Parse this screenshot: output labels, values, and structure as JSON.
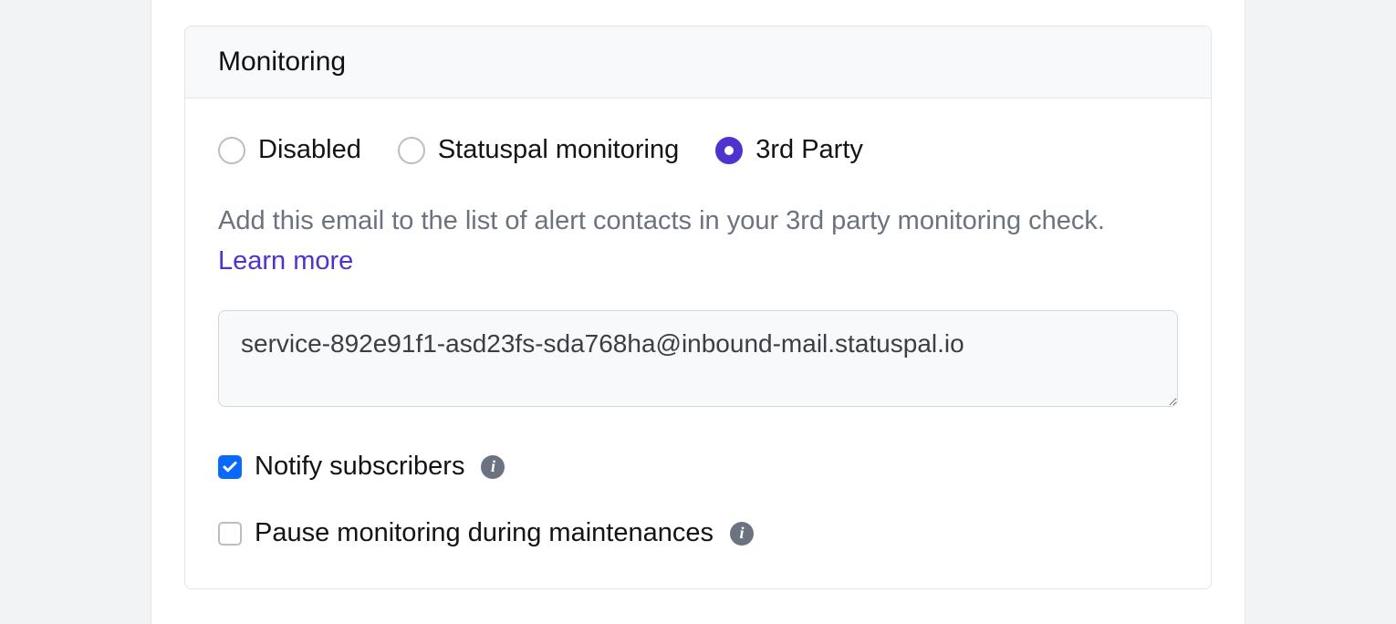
{
  "panel": {
    "title": "Monitoring"
  },
  "radios": {
    "disabled": "Disabled",
    "statuspal": "Statuspal monitoring",
    "third_party": "3rd Party",
    "selected": "third_party"
  },
  "help": {
    "text": "Add this email to the list of alert contacts in your 3rd party monitoring check. ",
    "link": "Learn more"
  },
  "email": {
    "value": "service-892e91f1-asd23fs-sda768ha@inbound-mail.statuspal.io"
  },
  "checkboxes": {
    "notify": {
      "label": "Notify subscribers",
      "checked": true
    },
    "pause": {
      "label": "Pause monitoring during maintenances",
      "checked": false
    }
  }
}
